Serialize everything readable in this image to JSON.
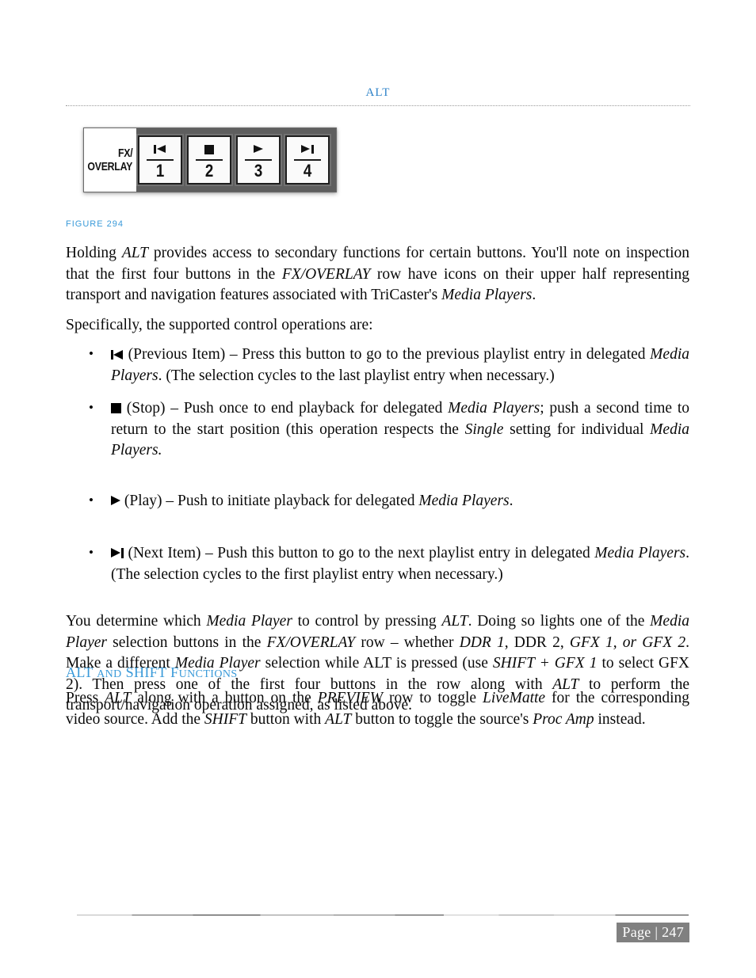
{
  "header": {
    "title": "ALT"
  },
  "figure": {
    "caption": "FIGURE 294",
    "row_label_line1": "FX/",
    "row_label_line2": "OVERLAY",
    "buttons": [
      {
        "icon": "previous-item-icon",
        "number": "1"
      },
      {
        "icon": "stop-icon",
        "number": "2"
      },
      {
        "icon": "play-icon",
        "number": "3"
      },
      {
        "icon": "next-item-icon",
        "number": "4"
      }
    ]
  },
  "body": {
    "intro_p1_a": "Holding ",
    "intro_p1_alt": "ALT",
    "intro_p1_b": " provides access to secondary functions for certain buttons.  You'll note on inspection that the first four buttons in the ",
    "intro_p1_fx": "FX/OVERLAY",
    "intro_p1_c": " row have icons on their upper half representing transport and navigation features associated with TriCaster's ",
    "intro_p1_mp": "Media Players",
    "intro_p1_d": ".",
    "intro_p2": "Specifically, the supported control operations are:",
    "bullets": [
      {
        "icon": "previous-item-icon",
        "a": " (Previous Item) – Press this button to go to the previous playlist entry in delegated ",
        "i1": "Media Players",
        "b": ". (The selection cycles to the last playlist entry when necessary.)"
      },
      {
        "icon": "stop-icon",
        "a": "  (Stop) – Push once to end playback for delegated ",
        "i1": "Media Players",
        "b": "; push a second time to return to the start position (this operation respects the ",
        "i2": "Single",
        "c": " setting for individual ",
        "i3": "Media Players.",
        "d": ""
      },
      {
        "icon": "play-icon",
        "a": "  (Play) – Push to initiate playback for delegated ",
        "i1": "Media Players",
        "b": "."
      },
      {
        "icon": "next-item-icon",
        "a": " (Next Item) – Push this button to go to the next playlist entry in delegated ",
        "i1": "Media Players",
        "b": ". (The selection cycles to the first playlist entry when necessary.)"
      }
    ],
    "summary": {
      "a": "You determine which ",
      "i1": "Media Player",
      "b": " to control by pressing ",
      "i2": "ALT",
      "c": ".  Doing so lights one of the ",
      "i3": "Media Player",
      "d": " selection buttons in the ",
      "i4": "FX/OVERLAY",
      "e": " row – whether ",
      "i5": "DDR 1",
      "f": ", DDR 2, ",
      "i6": "GFX 1, or GFX 2",
      "g": ".  Make a different ",
      "i7": "Media Player",
      "h": " selection while ALT is pressed (use ",
      "i8": "SHIFT + GFX 1",
      "j": " to select GFX 2).  Then press one of the first four buttons in the row along with ",
      "i9": "ALT",
      "k": " to perform the transport/navigation operation assigned, as listed above."
    }
  },
  "section": {
    "heading_parts": [
      {
        "text": "ALT",
        "caps": true
      },
      {
        "text": " ",
        "caps": true
      },
      {
        "text": "AND",
        "caps": false
      },
      {
        "text": " ",
        "caps": true
      },
      {
        "text": "SHIFT",
        "caps": true
      },
      {
        "text": " ",
        "caps": true
      },
      {
        "text": "F",
        "caps": true
      },
      {
        "text": "UNCTIONS",
        "caps": false
      }
    ],
    "heading_plain": "ALT and SHIFT Functions",
    "closing": {
      "a": "Press ",
      "i1": "ALT",
      "b": " along with a button on the ",
      "i2": "PREVIEW",
      "c": " row to toggle ",
      "i3": "LiveMatte",
      "d": " for the corresponding video source. Add the ",
      "i4": "SHIFT",
      "e": " button with ",
      "i5": "ALT",
      "f": " button to toggle the source's ",
      "i6": "Proc Amp",
      "g": " instead."
    }
  },
  "footer": {
    "page_label": "Page | 247"
  },
  "colors": {
    "accent_blue": "#3a9ad9",
    "header_blue": "#2e83c8",
    "console_gray": "#5e5e5e",
    "page_number_bg": "#808080"
  }
}
